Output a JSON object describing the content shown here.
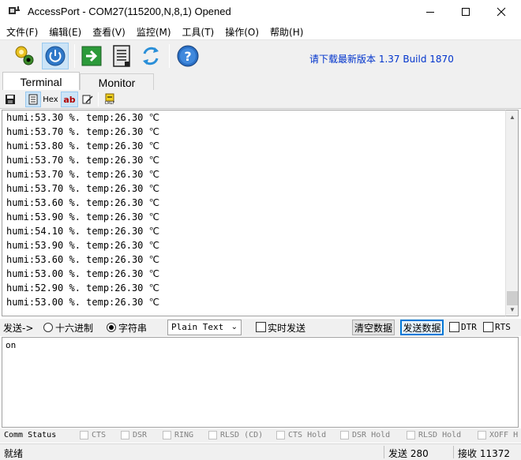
{
  "window": {
    "title": "AccessPort - COM27(115200,N,8,1) Opened",
    "minimize": "—",
    "maximize": "☐",
    "close": "✕"
  },
  "menu": [
    "文件(F)",
    "编辑(E)",
    "查看(V)",
    "监控(M)",
    "工具(T)",
    "操作(O)",
    "帮助(H)"
  ],
  "toolbar": {
    "update_text": "请下载最新版本 1.37 Build 1870",
    "icons": [
      "open-port-icon",
      "power-icon",
      "send-file-icon",
      "log-icon",
      "refresh-icon",
      "help-icon"
    ]
  },
  "tabs": [
    "Terminal",
    "Monitor"
  ],
  "subtoolbar": {
    "hex": "Hex",
    "ab": "ab",
    "crlf": "CRLF"
  },
  "terminal_lines": [
    "humi:53.30 %. temp:26.30 ℃",
    "humi:53.70 %. temp:26.30 ℃",
    "humi:53.80 %. temp:26.30 ℃",
    "humi:53.70 %. temp:26.30 ℃",
    "humi:53.70 %. temp:26.30 ℃",
    "humi:53.70 %. temp:26.30 ℃",
    "humi:53.60 %. temp:26.30 ℃",
    "humi:53.90 %. temp:26.30 ℃",
    "humi:54.10 %. temp:26.30 ℃",
    "humi:53.90 %. temp:26.30 ℃",
    "humi:53.60 %. temp:26.30 ℃",
    "humi:53.00 %. temp:26.30 ℃",
    "humi:52.90 %. temp:26.30 ℃",
    "humi:53.00 %. temp:26.30 ℃"
  ],
  "sendbar": {
    "label": "发送->",
    "hex_label": "十六进制",
    "string_label": "字符串",
    "string_selected": true,
    "format_value": "Plain Text",
    "realtime_label": "实时发送",
    "clear_button": "清空数据",
    "send_button": "发送数据",
    "dtr_label": "DTR",
    "rts_label": "RTS"
  },
  "input": {
    "value": "on"
  },
  "comm_status": {
    "label": "Comm Status",
    "items": [
      "CTS",
      "DSR",
      "RING",
      "RLSD (CD)",
      "CTS Hold",
      "DSR Hold",
      "RLSD Hold",
      "XOFF H"
    ]
  },
  "statusbar": {
    "state": "就绪",
    "sent": "发送 280",
    "received": "接收 11372"
  }
}
